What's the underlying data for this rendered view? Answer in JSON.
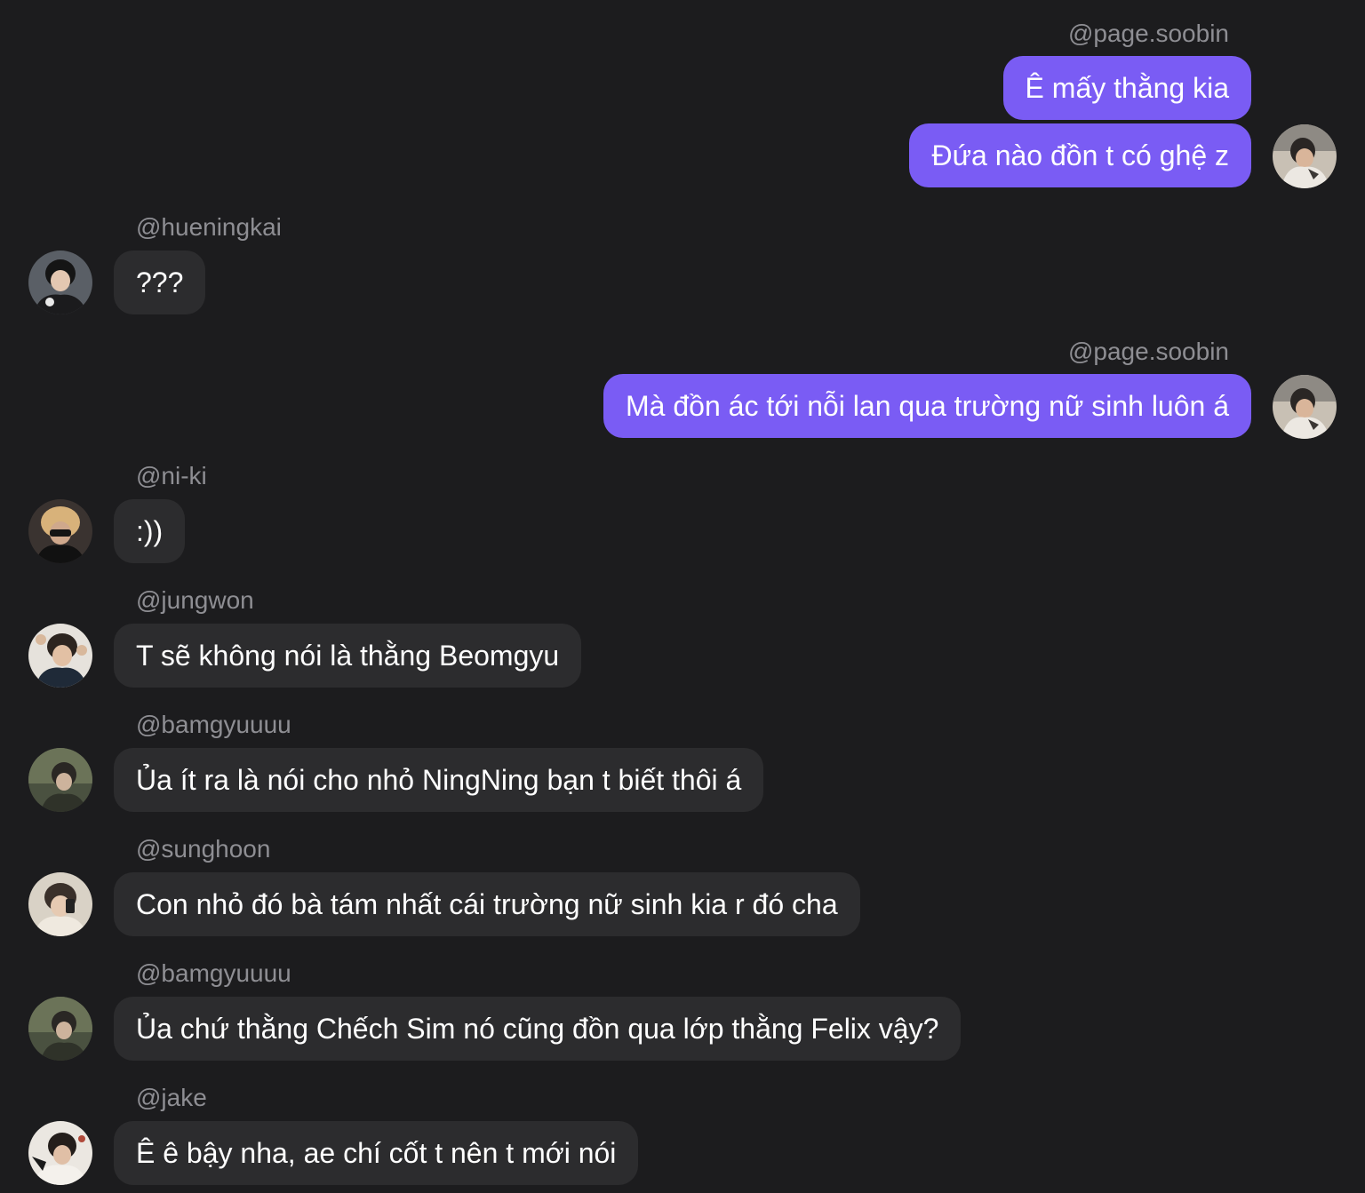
{
  "messages": [
    {
      "user": "@page.soobin",
      "lines": [
        "Ê mấy thằng kia",
        "Đứa nào đồn t có ghệ z"
      ]
    },
    {
      "user": "@hueningkai",
      "lines": [
        "???"
      ]
    },
    {
      "user": "@page.soobin",
      "lines": [
        "Mà đồn ác tới nỗi lan qua trường nữ sinh luôn á"
      ]
    },
    {
      "user": "@ni-ki",
      "lines": [
        ":))"
      ]
    },
    {
      "user": "@jungwon",
      "lines": [
        "T sẽ không nói là thằng Beomgyu"
      ]
    },
    {
      "user": "@bamgyuuuu",
      "lines": [
        "Ủa ít ra là nói cho nhỏ NingNing bạn t biết thôi á"
      ]
    },
    {
      "user": "@sunghoon",
      "lines": [
        "Con nhỏ đó bà tám nhất cái trường nữ sinh kia r đó cha"
      ]
    },
    {
      "user": "@bamgyuuuu",
      "lines": [
        "Ủa chứ thằng Chếch Sim nó cũng đồn qua lớp thằng Felix vậy?"
      ]
    },
    {
      "user": "@jake",
      "lines": [
        "Ê ê bậy nha, ae chí cốt t nên t mới nói"
      ]
    }
  ],
  "colors": {
    "background": "#1c1c1e",
    "outgoing_bubble": "#7a5cf4",
    "incoming_bubble": "#2c2c2e",
    "username": "#8e8e93"
  },
  "icons": {
    "avatar": "user-photo-avatar"
  }
}
